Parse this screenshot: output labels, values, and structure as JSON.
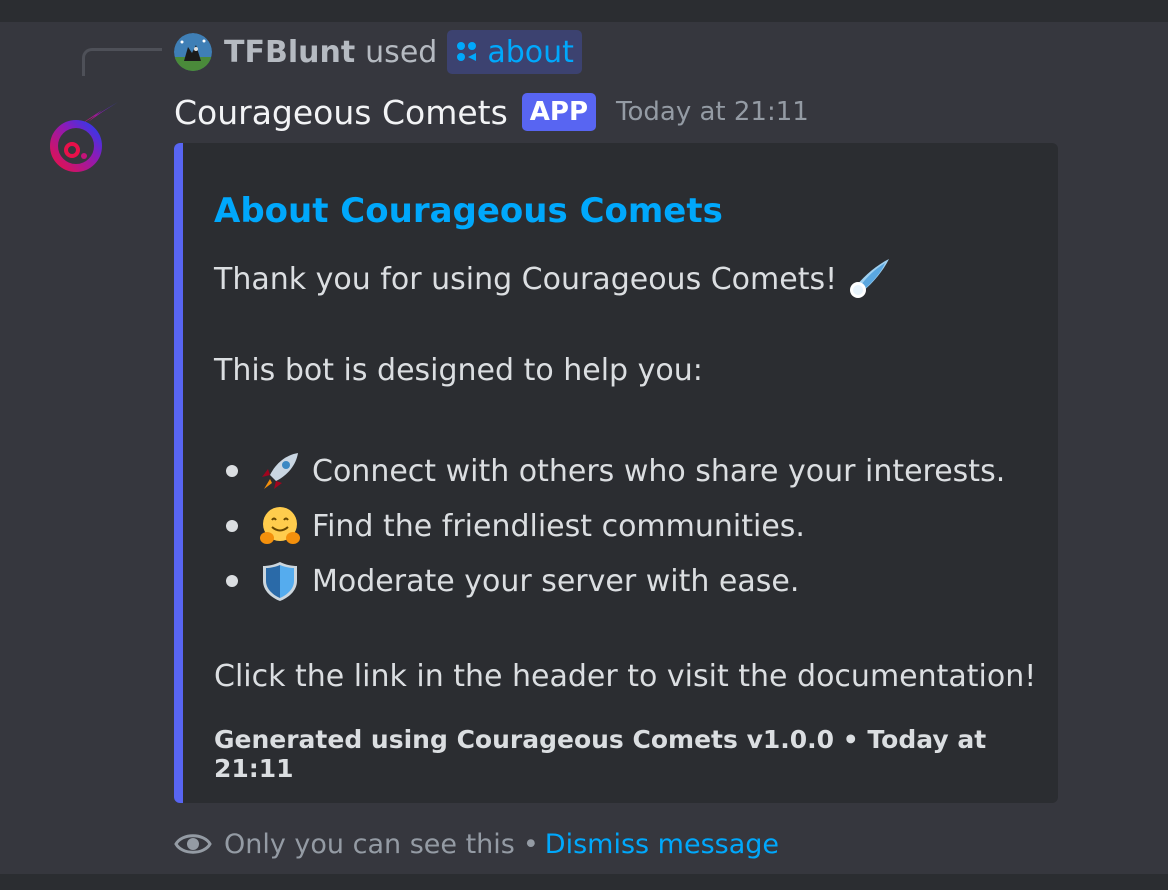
{
  "reply": {
    "username": "TFBlunt",
    "used_text": "used",
    "command": "about"
  },
  "message": {
    "bot_name": "Courageous Comets",
    "badge": "APP",
    "timestamp": "Today at 21:11"
  },
  "embed": {
    "accent_color": "#5865f2",
    "title": "About Courageous Comets",
    "intro": "Thank you for using Courageous Comets!",
    "intro_emoji": "comet-icon",
    "subheading": "This bot is designed to help you:",
    "bullets": [
      {
        "emoji": "rocket-icon",
        "text": "Connect with others who share your interests."
      },
      {
        "emoji": "hugging-face-icon",
        "text": "Find the friendliest communities."
      },
      {
        "emoji": "shield-icon",
        "text": "Moderate your server with ease."
      }
    ],
    "closing": "Click the link in the header to visit the documentation!",
    "footer": "Generated using Courageous Comets v1.0.0 • Today at 21:11"
  },
  "ephemeral": {
    "notice": "Only you can see this",
    "separator": "•",
    "dismiss_label": "Dismiss message"
  }
}
